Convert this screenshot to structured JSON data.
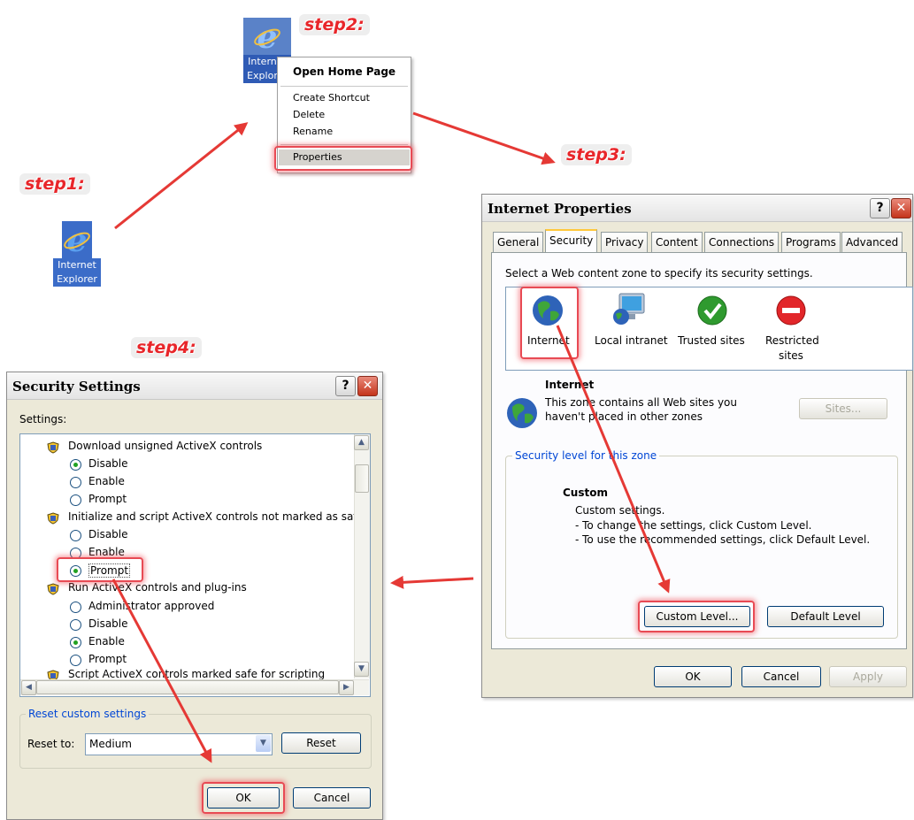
{
  "steps": {
    "step1": "step1:",
    "step2": "step2:",
    "step3": "step3:",
    "step4": "step4:"
  },
  "desktop_icon": {
    "line1": "Internet",
    "line2": "Explorer"
  },
  "context_icon": {
    "line1": "Internet",
    "line2": "Explorer"
  },
  "context_menu": {
    "open_home": "Open Home Page",
    "create_shortcut": "Create Shortcut",
    "delete": "Delete",
    "rename": "Rename",
    "properties": "Properties"
  },
  "internet_properties": {
    "title": "Internet Properties",
    "tabs": [
      "General",
      "Security",
      "Privacy",
      "Content",
      "Connections",
      "Programs",
      "Advanced"
    ],
    "select_zone_text": "Select a Web content zone to specify its security settings.",
    "zones": [
      "Internet",
      "Local intranet",
      "Trusted sites",
      "Restricted",
      "sites"
    ],
    "zone_title": "Internet",
    "zone_desc_line1": "This zone contains all Web sites you",
    "zone_desc_line2": "haven't placed in other zones",
    "sites_button": "Sites...",
    "security_level_legend": "Security level for this zone",
    "level_name": "Custom",
    "level_line1": "Custom settings.",
    "level_line2": "- To change the settings, click Custom Level.",
    "level_line3": "- To use the recommended settings, click Default Level.",
    "custom_level_button": "Custom Level...",
    "default_level_button": "Default Level",
    "ok": "OK",
    "cancel": "Cancel",
    "apply": "Apply"
  },
  "security_settings": {
    "title": "Security Settings",
    "settings_label": "Settings:",
    "groups": [
      {
        "title": "Download unsigned ActiveX controls",
        "options": [
          "Disable",
          "Enable",
          "Prompt"
        ]
      },
      {
        "title": "Initialize and script ActiveX controls not marked as safe",
        "options": [
          "Disable",
          "Enable",
          "Prompt"
        ]
      },
      {
        "title": "Run ActiveX controls and plug-ins",
        "options": [
          "Administrator approved",
          "Disable",
          "Enable",
          "Prompt"
        ]
      }
    ],
    "cut_off_item": "Script ActiveX controls marked safe for scripting",
    "reset_legend": "Reset custom settings",
    "reset_to_label": "Reset to:",
    "reset_to_value": "Medium",
    "reset_button": "Reset",
    "ok": "OK",
    "cancel": "Cancel"
  },
  "colors": {
    "arrow": "#e53935",
    "glow": "#e84a54",
    "step_text": "#e8262a",
    "dialog_bg": "#ece9d8"
  }
}
